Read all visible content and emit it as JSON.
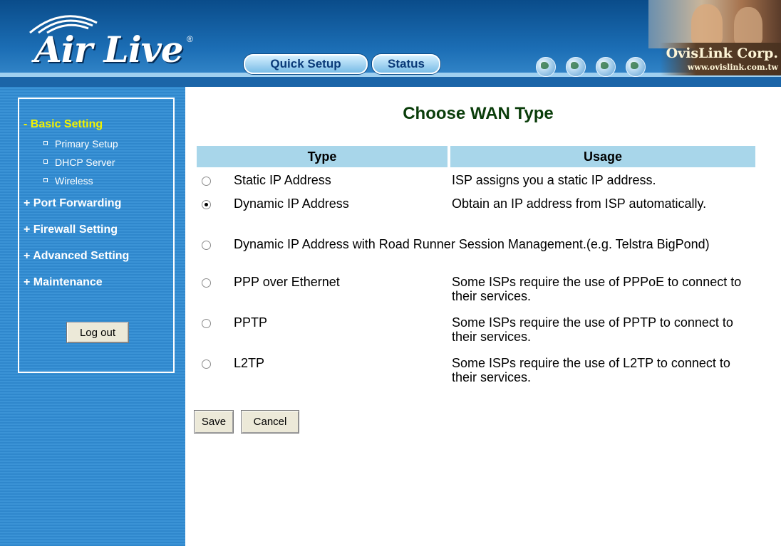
{
  "header": {
    "logo_text": "Air Live",
    "logo_reg": "®",
    "buttons": {
      "quick_setup": "Quick Setup",
      "status": "Status"
    },
    "corp_name": "OvisLink Corp.",
    "corp_url": "www.ovislink.com.tw"
  },
  "sidebar": {
    "active_section": "- Basic Setting",
    "sub_items": [
      "Primary Setup",
      "DHCP Server",
      "Wireless"
    ],
    "sections": [
      "+ Port Forwarding",
      "+ Firewall Setting",
      "+ Advanced Setting",
      "+ Maintenance"
    ],
    "logout_label": "Log out"
  },
  "main": {
    "title": "Choose WAN Type",
    "columns": {
      "type": "Type",
      "usage": "Usage"
    },
    "options": [
      {
        "type": "Static IP Address",
        "usage": "ISP assigns you a static IP address.",
        "selected": false
      },
      {
        "type": "Dynamic IP Address",
        "usage": "Obtain an IP address from ISP automatically.",
        "selected": true
      },
      {
        "full": "Dynamic IP Address with Road Runner Session Management.(e.g. Telstra BigPond)",
        "selected": false
      },
      {
        "type": "PPP over Ethernet",
        "usage": "Some ISPs require the use of PPPoE to connect to their services.",
        "selected": false
      },
      {
        "type": "PPTP",
        "usage": "Some ISPs require the use of PPTP to connect to their services.",
        "selected": false
      },
      {
        "type": "L2TP",
        "usage": "Some ISPs require the use of L2TP to connect to their services.",
        "selected": false
      }
    ],
    "save_label": "Save",
    "cancel_label": "Cancel"
  }
}
